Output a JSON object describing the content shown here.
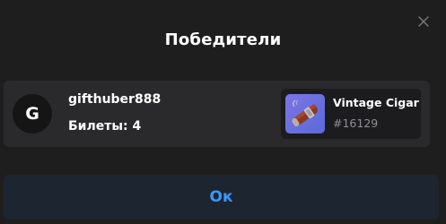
{
  "modal": {
    "title": "Победители",
    "close_icon": "close-icon",
    "ok_label": "Ок"
  },
  "winner": {
    "avatar_letter": "G",
    "username": "gifthuber888",
    "tickets": "Билеты: 4"
  },
  "prize": {
    "icon": "cigar-icon",
    "name": "Vintage Cigar",
    "id": "#16129"
  },
  "colors": {
    "background": "#1e1e1e",
    "card": "#2a2a2c",
    "prize_card": "#1c1c1e",
    "accent": "#3a97ff",
    "button_bg": "#1c2530",
    "muted_text": "#8e8e93",
    "prize_thumb": "#7c74e8"
  }
}
